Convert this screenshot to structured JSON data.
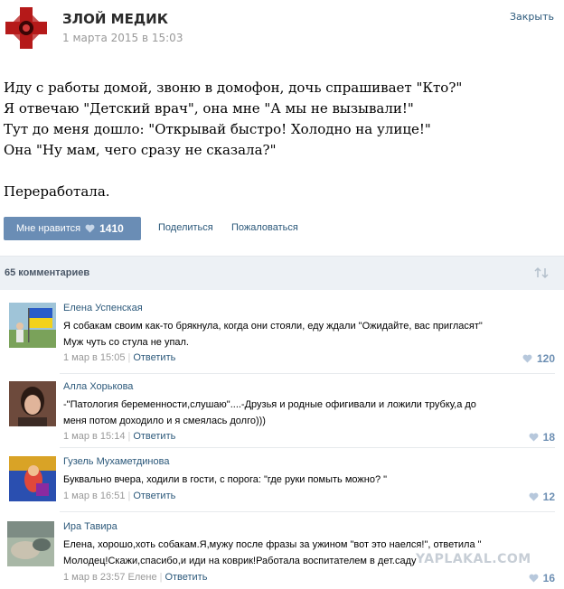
{
  "post": {
    "author": "ЗЛОЙ МЕДИК",
    "date": "1 марта 2015 в 15:03",
    "close_label": "Закрыть",
    "text_lines": [
      "Иду с работы домой, звоню в домофон, дочь спрашивает \"Кто?\"",
      "Я отвечаю \"Детский врач\", она мне \"А мы не вызывали!\"",
      "Тут до меня дошло: \"Открывай быстро! Холодно на улице!\"",
      "Она \"Ну мам, чего сразу не сказала?\""
    ],
    "text_final": "Переработала.",
    "like_label": "Мне нравится",
    "like_count": "1410",
    "share_label": "Поделиться",
    "complain_label": "Пожаловаться"
  },
  "comments_header": {
    "count_label": "65 комментариев"
  },
  "comments": [
    {
      "name": "Елена Успенская",
      "lines": [
        "Я собакам своим как-то брякнула, когда они стояли, еду ждали \"Ожидайте, вас пригласят\"",
        "Муж чуть со стула не упал."
      ],
      "date": "1 мар в 15:05",
      "reply": "Ответить",
      "likes": "120"
    },
    {
      "name": "Алла Хорькова",
      "lines": [
        "-\"Патология беременности,слушаю\"....-Друзья и родные офигивали и ложили трубку,а до",
        "меня потом доходило и я смеялась долго)))"
      ],
      "date": "1 мар в 15:14",
      "reply": "Ответить",
      "likes": "18"
    },
    {
      "name": "Гузель Мухаметдинова",
      "lines": [
        "Буквально вчера, ходили в гости, с порога: \"где руки помыть можно? \""
      ],
      "date": "1 мар в 16:51",
      "reply": "Ответить",
      "likes": "12"
    },
    {
      "name": "Ира Тавира",
      "lines": [
        "Елена, хорошо,хоть собакам.Я,мужу после фразы за ужином \"вот это наелся!\", ответила \"",
        "Молодец!Скажи,спасибо,и иди на коврик!Работала воспитателем в дет.саду"
      ],
      "date": "1 мар в 23:57 Елене",
      "reply": "Ответить",
      "likes": "16"
    }
  ],
  "watermark": "YAPLAKAL.COM",
  "colors": {
    "link": "#2b587a",
    "like_button": "#6a8db5",
    "bar_bg": "#edf1f5",
    "avatar_red": "#b51a1a"
  }
}
